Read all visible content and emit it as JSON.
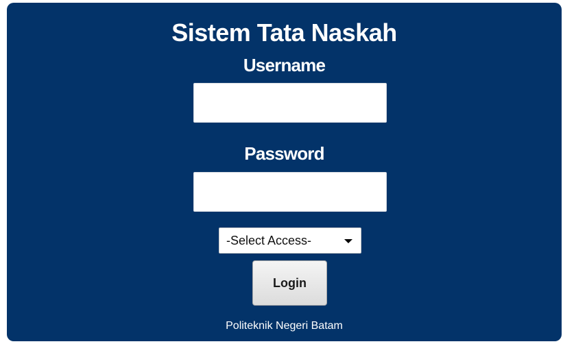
{
  "login": {
    "title": "Sistem Tata Naskah",
    "username_label": "Username",
    "username_value": "",
    "password_label": "Password",
    "password_value": "",
    "access_select": {
      "selected": "-Select Access-"
    },
    "login_button_label": "Login",
    "footer_text": "Politeknik Negeri Batam"
  },
  "colors": {
    "panel_background": "#033369",
    "text": "#ffffff",
    "button": "#e6e6e6"
  }
}
